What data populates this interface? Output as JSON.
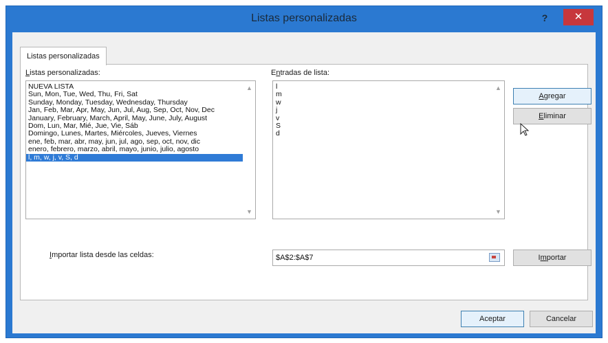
{
  "window": {
    "title": "Listas personalizadas",
    "help_label": "?",
    "close_label": "✕"
  },
  "tab": {
    "label": "Listas personalizadas"
  },
  "custom_lists": {
    "label_prefix": "",
    "label_u": "L",
    "label_rest": "istas personalizadas:",
    "items": [
      "NUEVA LISTA",
      "Sun, Mon, Tue, Wed, Thu, Fri, Sat",
      "Sunday, Monday, Tuesday, Wednesday, Thursday",
      "Jan, Feb, Mar, Apr, May, Jun, Jul, Aug, Sep, Oct, Nov, Dec",
      "January, February, March, April, May, June, July, August",
      "Dom, Lun, Mar, Mié, Jue, Vie, Sáb",
      "Domingo, Lunes, Martes, Miércoles, Jueves, Viernes",
      "ene, feb, mar, abr, may, jun, jul, ago, sep, oct, nov, dic",
      "enero, febrero, marzo, abril, mayo, junio, julio, agosto",
      "l, m, w, j, v, S, d"
    ],
    "selected_index": 9
  },
  "entries": {
    "label_prefix": "E",
    "label_u": "n",
    "label_rest": "tradas de lista:",
    "value": "l\nm\nw\nj\nv\nS\nd"
  },
  "buttons": {
    "agregar_prefix": "",
    "agregar_u": "A",
    "agregar_rest": "gregar",
    "eliminar_prefix": "",
    "eliminar_u": "E",
    "eliminar_rest": "liminar",
    "importar_prefix": "I",
    "importar_u": "m",
    "importar_rest": "portar",
    "aceptar": "Aceptar",
    "cancelar": "Cancelar"
  },
  "import": {
    "label_prefix": "",
    "label_u": "I",
    "label_rest": "mportar lista desde las celdas:",
    "value": "$A$2:$A$7"
  },
  "colors": {
    "titlebar": "#2b79d1",
    "close": "#c7373c",
    "selection": "#2f7bd6"
  }
}
